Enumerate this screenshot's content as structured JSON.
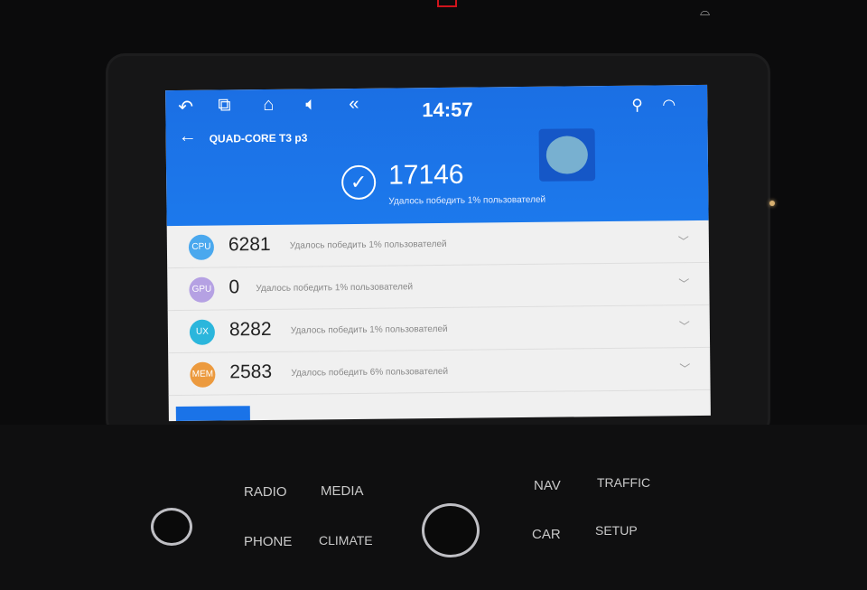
{
  "statusbar": {
    "time": "14:57",
    "icons": [
      "back-arrow-icon",
      "recent-apps-icon",
      "home-icon",
      "volume-icon",
      "rewind-icon",
      "location-icon",
      "wifi-icon"
    ]
  },
  "app": {
    "device_title": "QUAD-CORE T3 p3",
    "total_score": "17146",
    "total_subtitle": "Удалось победить 1% пользователей"
  },
  "scores": [
    {
      "badge": "CPU",
      "value": "6281",
      "desc": "Удалось победить 1% пользователей",
      "color": "#4aa8ee"
    },
    {
      "badge": "GPU",
      "value": "0",
      "desc": "Удалось победить 1% пользователей",
      "color": "#b5a1e3"
    },
    {
      "badge": "UX",
      "value": "8282",
      "desc": "Удалось победить 1% пользователей",
      "color": "#2bb6dc"
    },
    {
      "badge": "MEM",
      "value": "2583",
      "desc": "Удалось победить 6% пользователей",
      "color": "#ec9a3e"
    }
  ],
  "hardware": {
    "radio": "RADIO",
    "media": "MEDIA",
    "phone": "PHONE",
    "climate": "CLIMATE",
    "nav": "NAV",
    "traffic": "TRAFFIC",
    "car": "CAR",
    "setup": "SETUP"
  }
}
